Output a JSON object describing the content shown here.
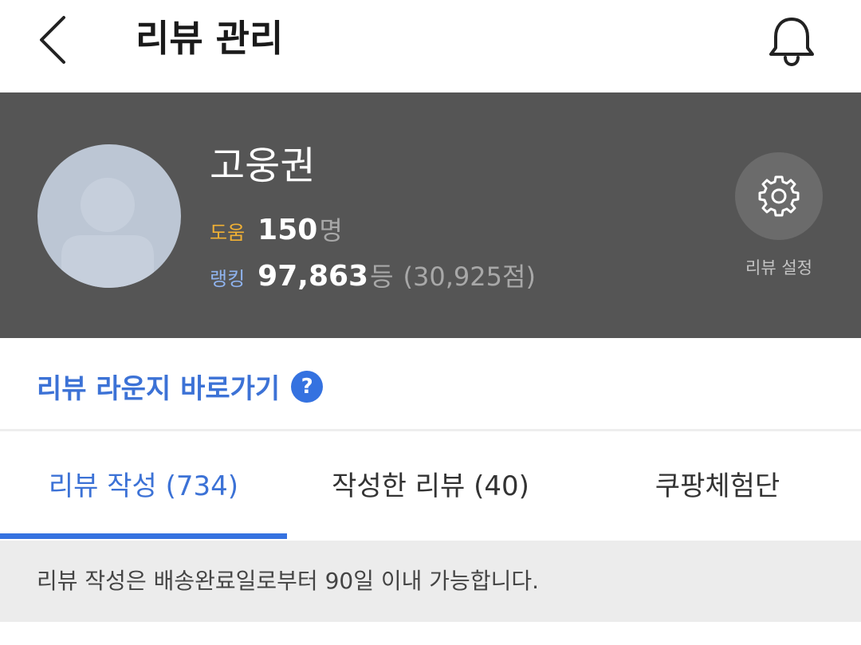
{
  "header": {
    "title": "리뷰 관리",
    "back_icon": "chevron-left-icon",
    "bell_icon": "bell-icon"
  },
  "profile": {
    "name": "고웅권",
    "help_label": "도움",
    "help_count": "150",
    "help_unit": "명",
    "rank_label": "랭킹",
    "rank_value": "97,863",
    "rank_unit": "등",
    "rank_points": "(30,925점)",
    "settings_icon": "gear-icon",
    "settings_label": "리뷰 설정"
  },
  "lounge": {
    "link_text": "리뷰 라운지 바로가기",
    "help_mark": "?"
  },
  "tabs": [
    {
      "label": "리뷰 작성 (734)",
      "active": true
    },
    {
      "label": "작성한 리뷰 (40)",
      "active": false
    },
    {
      "label": "쿠팡체험단",
      "active": false
    }
  ],
  "notice": {
    "text": "리뷰 작성은 배송완료일로부터 90일 이내 가능합니다."
  },
  "colors": {
    "accent": "#3572e0",
    "profile_bg": "#555555",
    "help_label": "#f2b134",
    "rank_label": "#8fb3ee"
  }
}
